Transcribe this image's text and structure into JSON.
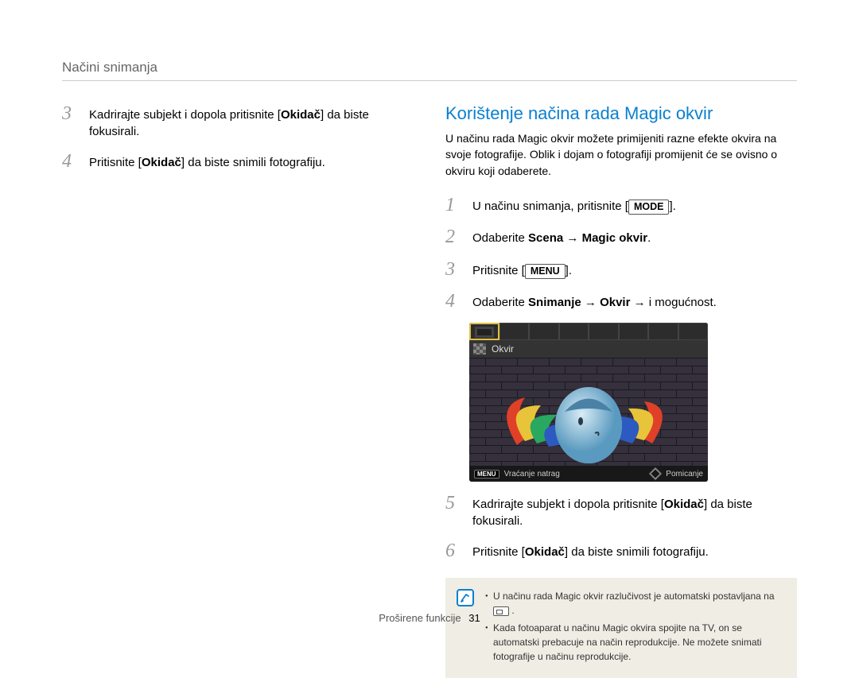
{
  "header": "Načini snimanja",
  "left": {
    "steps": [
      {
        "num": "3",
        "parts": [
          "Kadrirajte subjekt i dopola pritisnite [",
          {
            "b": "Okidač"
          },
          "] da biste fokusirali."
        ]
      },
      {
        "num": "4",
        "parts": [
          "Pritisnite [",
          {
            "b": "Okidač"
          },
          "] da biste snimili fotografiju."
        ]
      }
    ]
  },
  "right": {
    "title": "Korištenje načina rada Magic okvir",
    "intro": "U načinu rada Magic okvir možete primijeniti razne efekte okvira na svoje fotografije. Oblik i dojam o fotografiji promijenit će se ovisno o okviru koji odaberete.",
    "steps": [
      {
        "num": "1",
        "parts": [
          "U načinu snimanja, pritisnite [",
          {
            "cap": "MODE"
          },
          "]."
        ]
      },
      {
        "num": "2",
        "parts": [
          "Odaberite ",
          {
            "b": "Scena"
          },
          " → ",
          {
            "b": "Magic okvir"
          },
          "."
        ]
      },
      {
        "num": "3",
        "parts": [
          "Pritisnite [",
          {
            "cap": "MENU"
          },
          "]."
        ]
      },
      {
        "num": "4",
        "parts": [
          "Odaberite ",
          {
            "b": "Snimanje"
          },
          " → ",
          {
            "b": "Okvir"
          },
          " → i mogućnost."
        ]
      },
      {
        "num": "5",
        "parts": [
          "Kadrirajte subjekt i dopola pritisnite [",
          {
            "b": "Okidač"
          },
          "] da biste fokusirali."
        ]
      },
      {
        "num": "6",
        "parts": [
          "Pritisnite [",
          {
            "b": "Okidač"
          },
          "] da biste snimili fotografiju."
        ]
      }
    ],
    "screenshot": {
      "label": "Okvir",
      "menu_key": "MENU",
      "back_text": "Vraćanje natrag",
      "scroll_text": "Pomicanje"
    },
    "note": [
      "U načinu rada Magic okvir razlučivost je automatski postavljana na {SIZECHIP} .",
      "Kada fotoaparat u načinu Magic okvira spojite na TV, on se automatski prebacuje na način reprodukcije. Ne možete snimati fotografije u načinu reprodukcije."
    ]
  },
  "footer": {
    "section": "Proširene funkcije",
    "page": "31"
  }
}
